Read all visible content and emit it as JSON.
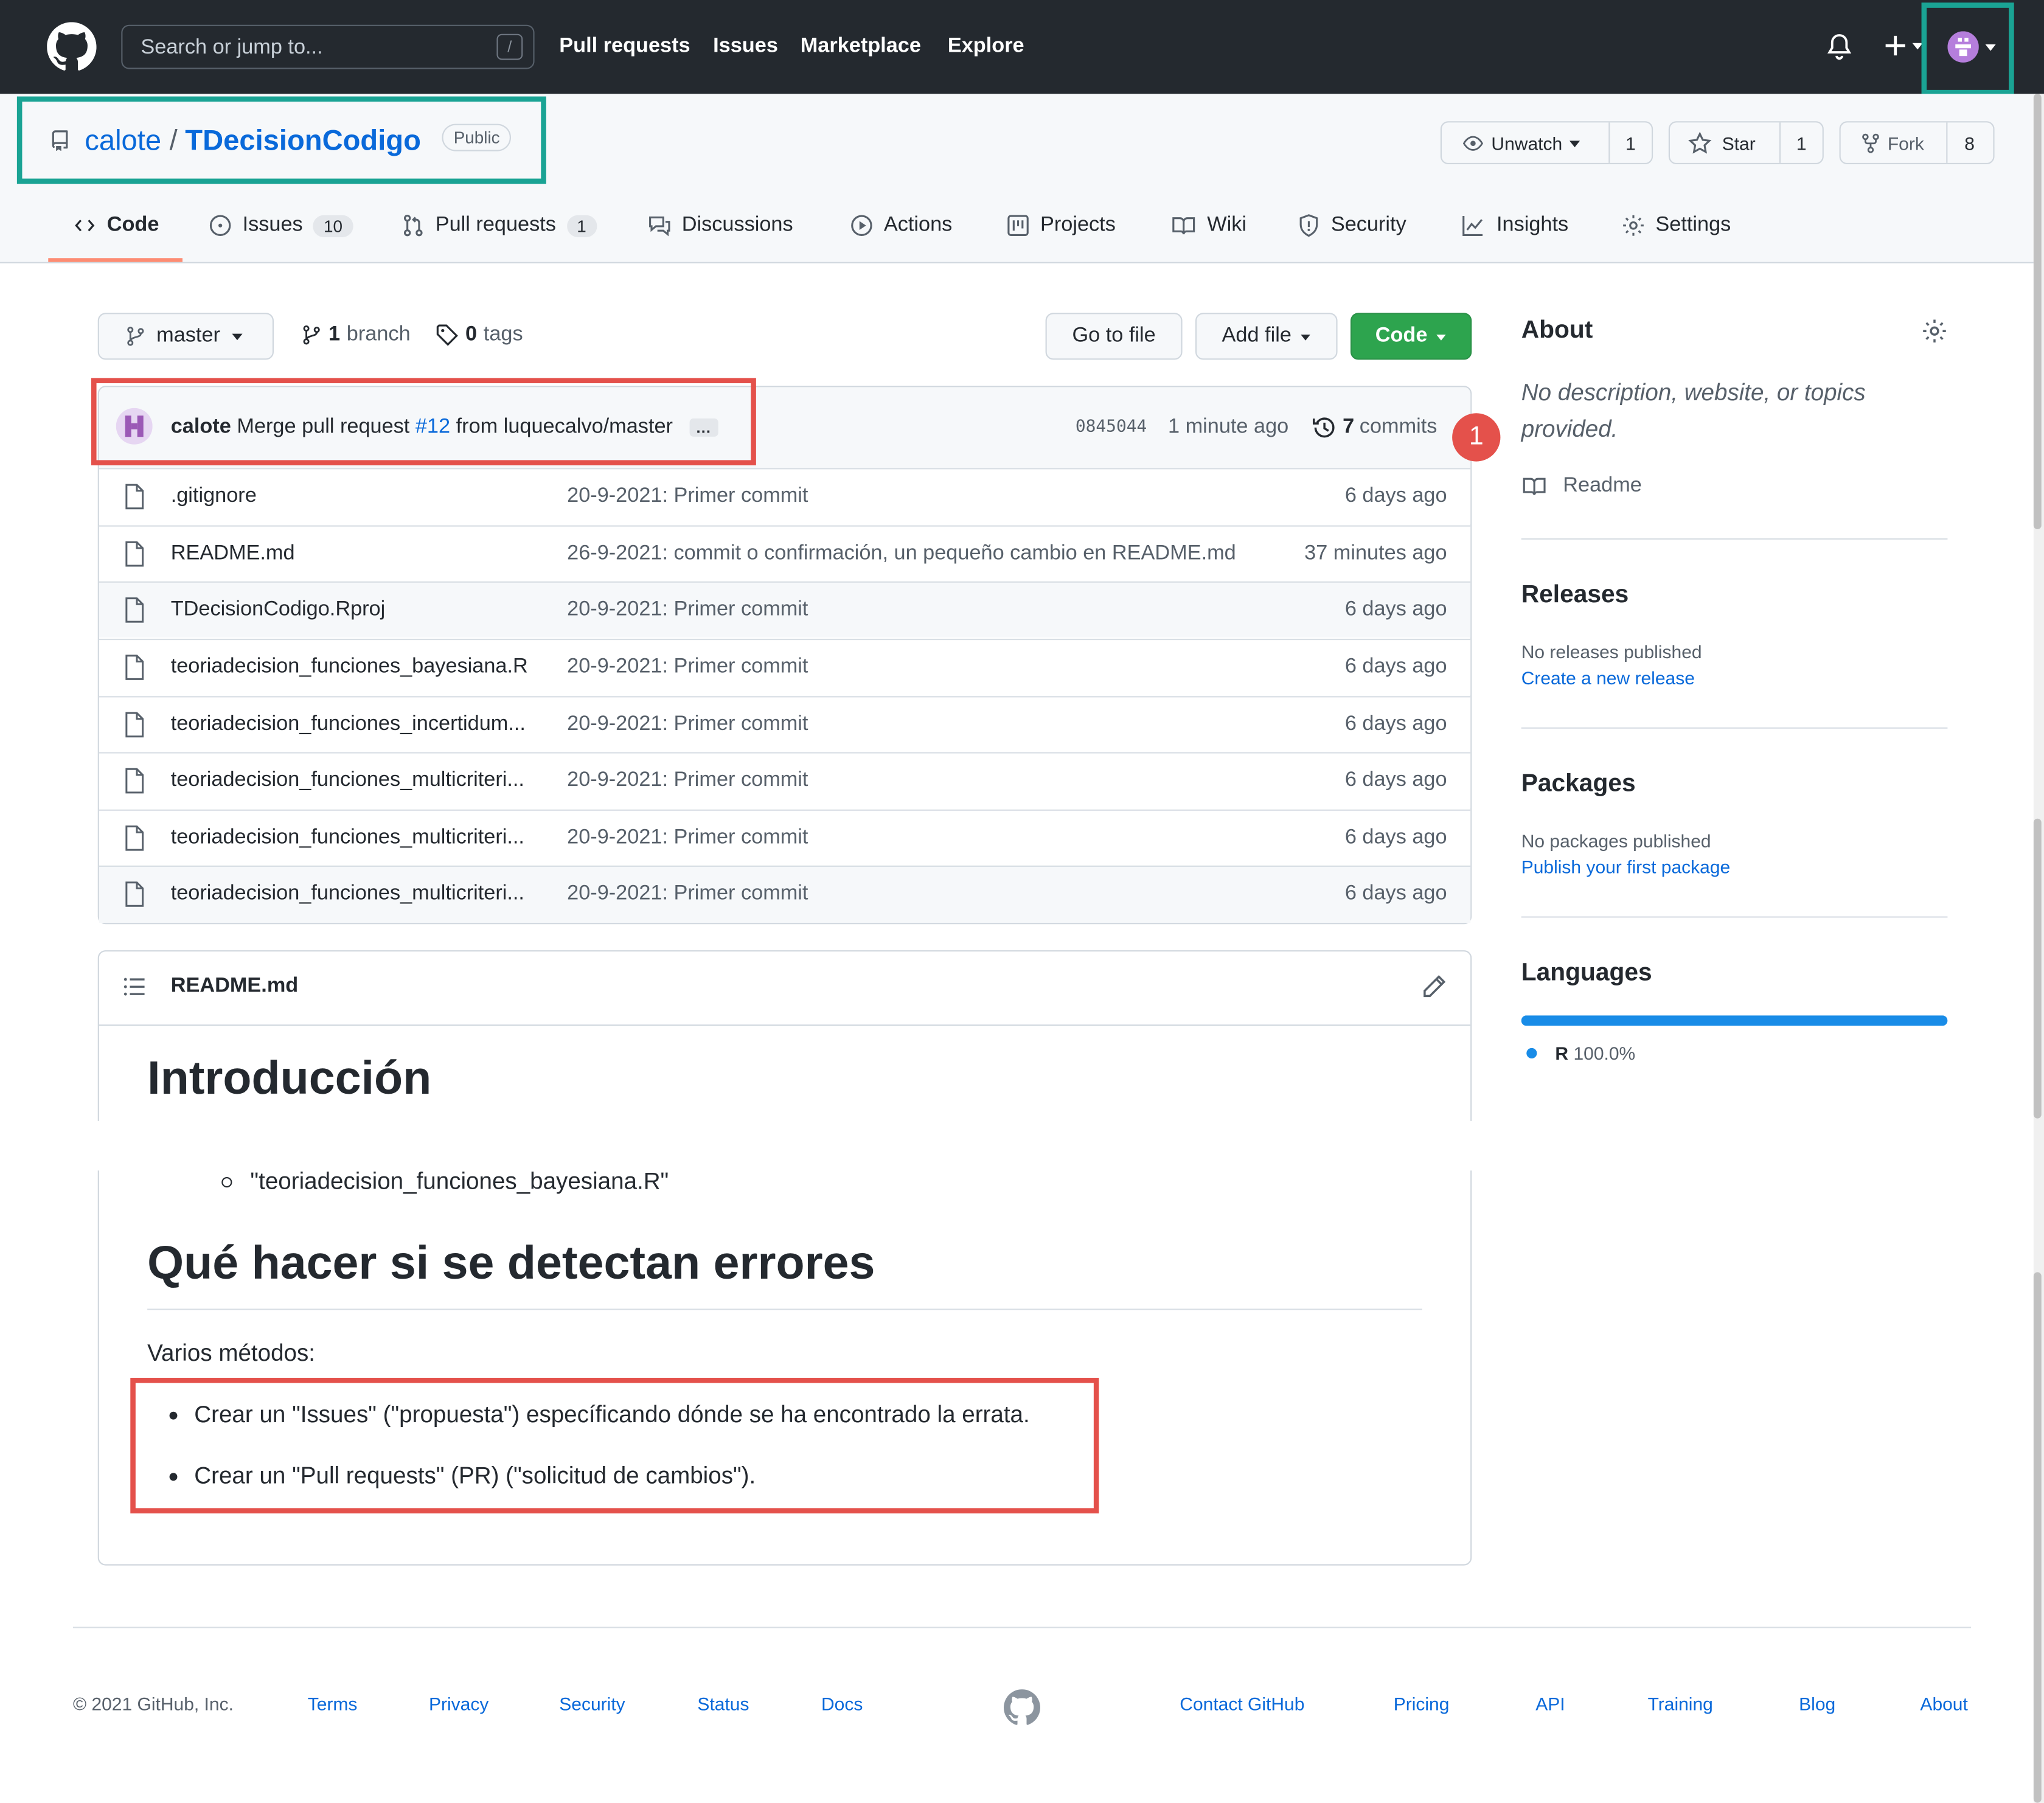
{
  "header": {
    "search_placeholder": "Search or jump to...",
    "slash_key": "/",
    "nav": [
      "Pull requests",
      "Issues",
      "Marketplace",
      "Explore"
    ]
  },
  "repo": {
    "owner": "calote",
    "separator": "/",
    "name": "TDecisionCodigo",
    "visibility": "Public",
    "unwatch_label": "Unwatch",
    "watch_count": "1",
    "star_label": "Star",
    "star_count": "1",
    "fork_label": "Fork",
    "fork_count": "8"
  },
  "tabs": [
    {
      "label": "Code"
    },
    {
      "label": "Issues",
      "count": "10"
    },
    {
      "label": "Pull requests",
      "count": "1"
    },
    {
      "label": "Discussions"
    },
    {
      "label": "Actions"
    },
    {
      "label": "Projects"
    },
    {
      "label": "Wiki"
    },
    {
      "label": "Security"
    },
    {
      "label": "Insights"
    },
    {
      "label": "Settings"
    }
  ],
  "toolbar": {
    "branch": "master",
    "branch_count": "1",
    "branch_word": "branch",
    "tag_count": "0",
    "tag_word": "tags",
    "go_to_file": "Go to file",
    "add_file": "Add file",
    "code": "Code"
  },
  "commit": {
    "author": "calote",
    "message_pre": "Merge pull request",
    "pr_link": "#12",
    "message_post": "from luquecalvo/master",
    "ellipsis": "…",
    "sha": "0845044",
    "time": "1 minute ago",
    "commits_count": "7",
    "commits_word": "commits",
    "badge": "1"
  },
  "files": [
    {
      "name": ".gitignore",
      "message": "20-9-2021: Primer commit",
      "age": "6 days ago"
    },
    {
      "name": "README.md",
      "message": "26-9-2021: commit o confirmación, un pequeño cambio en README.md",
      "age": "37 minutes ago"
    },
    {
      "name": "TDecisionCodigo.Rproj",
      "message": "20-9-2021: Primer commit",
      "age": "6 days ago"
    },
    {
      "name": "teoriadecision_funciones_bayesiana.R",
      "message": "20-9-2021: Primer commit",
      "age": "6 days ago"
    },
    {
      "name": "teoriadecision_funciones_incertidum...",
      "message": "20-9-2021: Primer commit",
      "age": "6 days ago"
    },
    {
      "name": "teoriadecision_funciones_multicriteri...",
      "message": "20-9-2021: Primer commit",
      "age": "6 days ago"
    },
    {
      "name": "teoriadecision_funciones_multicriteri...",
      "message": "20-9-2021: Primer commit",
      "age": "6 days ago"
    },
    {
      "name": "teoriadecision_funciones_multicriteri...",
      "message": "20-9-2021: Primer commit",
      "age": "6 days ago"
    }
  ],
  "readme": {
    "title": "README.md",
    "h_intro": "Introducción",
    "sub_item": "\"teoriadecision_funciones_bayesiana.R\"",
    "h_errors": "Qué hacer si se detectan errores",
    "methods_label": "Varios métodos:",
    "bullets": [
      "Crear un \"Issues\" (\"propuesta\") específicando dónde se ha encontrado la errata.",
      "Crear un \"Pull requests\" (PR) (\"solicitud de cambios\")."
    ]
  },
  "sidebar": {
    "about_title": "About",
    "about_desc": "No description, website, or topics provided.",
    "readme_link": "Readme",
    "releases_title": "Releases",
    "releases_none": "No releases published",
    "releases_link": "Create a new release",
    "packages_title": "Packages",
    "packages_none": "No packages published",
    "packages_link": "Publish your first package",
    "languages_title": "Languages",
    "language_name": "R",
    "language_pct": "100.0%",
    "language_fraction": 1.0
  },
  "footer": {
    "copyright": "© 2021 GitHub, Inc.",
    "left_links": [
      "Terms",
      "Privacy",
      "Security",
      "Status",
      "Docs"
    ],
    "right_links": [
      "Contact GitHub",
      "Pricing",
      "API",
      "Training",
      "Blog",
      "About"
    ]
  },
  "colors": {
    "header_bg": "#24292f",
    "link": "#0969da",
    "code_button": "#2da44e",
    "annotation_teal": "#1aa394",
    "annotation_red": "#e4514b",
    "language_r": "#198ce7"
  }
}
